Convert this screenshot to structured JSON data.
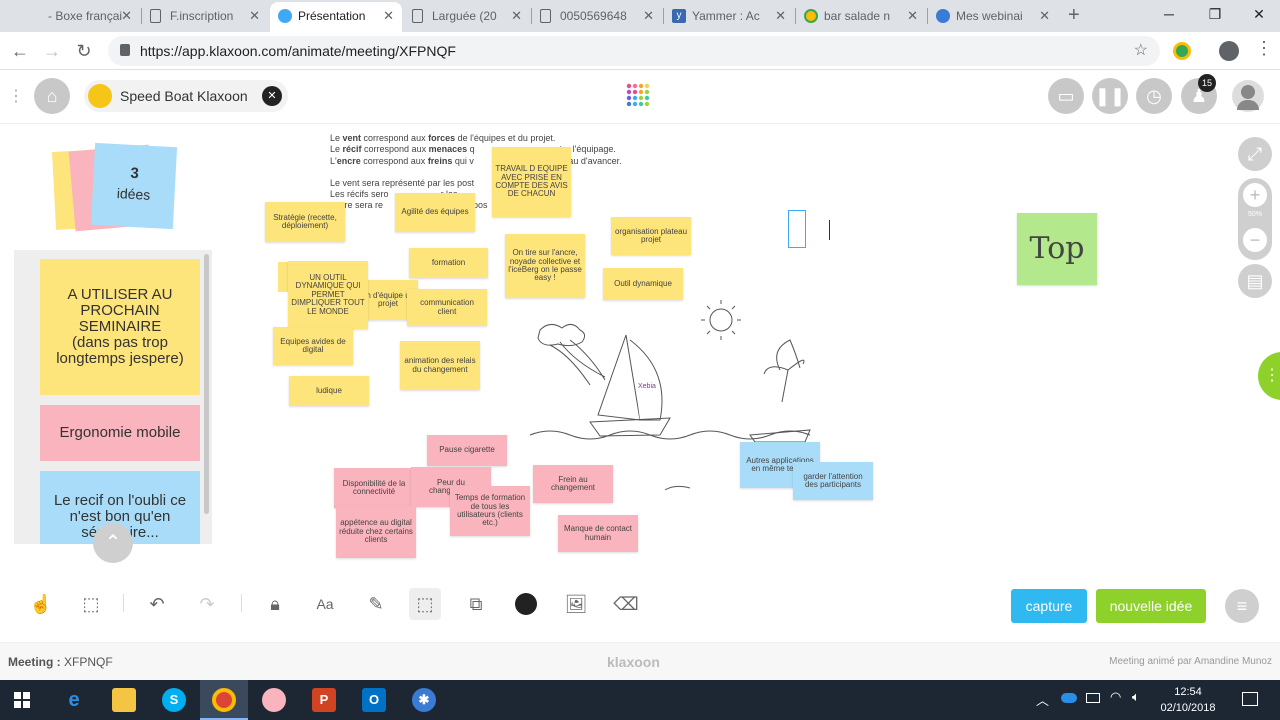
{
  "browser": {
    "tabs": [
      {
        "title": "- Boxe françai",
        "favicon_color": "#d93025"
      },
      {
        "title": "F.inscription",
        "favicon_color": "#5f6368"
      },
      {
        "title": "Présentation",
        "favicon_color": "#3fa9f5"
      },
      {
        "title": "Larguée (20",
        "favicon_color": "#5f6368"
      },
      {
        "title": "0050569648",
        "favicon_color": "#5f6368"
      },
      {
        "title": "Yammer : Ac",
        "favicon_color": "#396ab1"
      },
      {
        "title": "bar salade n",
        "favicon_color": "#fbbc05"
      },
      {
        "title": "Mes webinai",
        "favicon_color": "#3a7bd5"
      }
    ],
    "new_tab": "+",
    "url": "https://app.klaxoon.com/animate/meeting/XFPNQF"
  },
  "header": {
    "meeting_title": "Speed Boat Klaxoon",
    "participants_badge": "15"
  },
  "ideas": {
    "count": "3",
    "label": "idées"
  },
  "sidebar_cards": [
    {
      "line1": "A UTILISER AU PROCHAIN SEMINAIRE",
      "line2": "(dans pas trop longtemps jespere)"
    },
    {
      "line1": "Ergonomie mobile",
      "line2": ""
    },
    {
      "line1": "Le recif on l'oubli ce n'est bon qu'en séminaire...",
      "line2": ""
    }
  ],
  "instructions": {
    "l1_a": "Le ",
    "l1_b": "vent",
    "l1_c": " correspond aux ",
    "l1_d": "forces",
    "l1_e": " de l'équipes et du projet.",
    "l2_a": "Le ",
    "l2_b": "récif",
    "l2_c": " correspond aux ",
    "l2_d": "menaces",
    "l2_e": " q",
    "l2_f": "nter l'équipage.",
    "l3_a": "L'",
    "l3_b": "encre",
    "l3_c": " correspond aux ",
    "l3_d": "freins",
    "l3_e": " qui v",
    "l3_f": "ateau d'avancer.",
    "l4": "Le vent sera représenté par les post",
    "l5": "Les récifs sero",
    "l5_b": "r les",
    "l6": "encre sera re",
    "l6_b": "pos"
  },
  "board_notes": [
    {
      "text": "TRAVAIL D EQUIPE AVEC PRISE EN COMPTE DES AVIS DE CHACUN",
      "color": "yellow"
    },
    {
      "text": "Stratégie (recette, déploiement)",
      "color": "yellow"
    },
    {
      "text": "Agilité des équipes",
      "color": "yellow"
    },
    {
      "text": "organisation plateau projet",
      "color": "yellow"
    },
    {
      "text": "On tire sur l'ancre, noyade collective et l'iceBerg on le passe easy !",
      "color": "yellow"
    },
    {
      "text": "formation",
      "color": "yellow"
    },
    {
      "text": "Outil dynamique",
      "color": "yellow"
    },
    {
      "text": "UN OUTIL DYNAMIQUE QUI PERMET DIMPLIQUER TOUT LE MONDE",
      "color": "yellow"
    },
    {
      "text": "on d'équipe un projet",
      "color": "yellow"
    },
    {
      "text": "communication client",
      "color": "yellow"
    },
    {
      "text": "Equipes avides de digital",
      "color": "yellow"
    },
    {
      "text": "animation des relais du changement",
      "color": "yellow"
    },
    {
      "text": "ludique",
      "color": "yellow"
    },
    {
      "text": "Pause cigarette",
      "color": "pink"
    },
    {
      "text": "Disponibilité de la connectivité",
      "color": "pink"
    },
    {
      "text": "Peur du changement",
      "color": "pink"
    },
    {
      "text": "Temps de formation de tous les utilisateurs (clients etc.)",
      "color": "pink"
    },
    {
      "text": "Frein au changement",
      "color": "pink"
    },
    {
      "text": "appétence au digital réduite chez certains clients",
      "color": "pink"
    },
    {
      "text": "Manque de contact humain",
      "color": "pink"
    },
    {
      "text": "Autres applications en même temps",
      "color": "blue"
    },
    {
      "text": "garder l'attention des participants",
      "color": "blue"
    },
    {
      "text": "Top",
      "color": "green"
    }
  ],
  "zoom_level": "50%",
  "actions": {
    "capture": "capture",
    "new_idea": "nouvelle idée"
  },
  "footer": {
    "meeting_label": "Meeting :",
    "meeting_code": "XFPNQF",
    "brand": "klaxoon",
    "animated_by": "Meeting animé par Amandine Munoz"
  },
  "taskbar": {
    "time": "12:54",
    "date": "02/10/2018"
  },
  "colors": {
    "accent_blue": "#2fb9f0",
    "accent_green": "#8fd12b",
    "note_yellow": "#fde47b",
    "note_pink": "#f9b4bd",
    "note_blue": "#a9dcf9"
  }
}
